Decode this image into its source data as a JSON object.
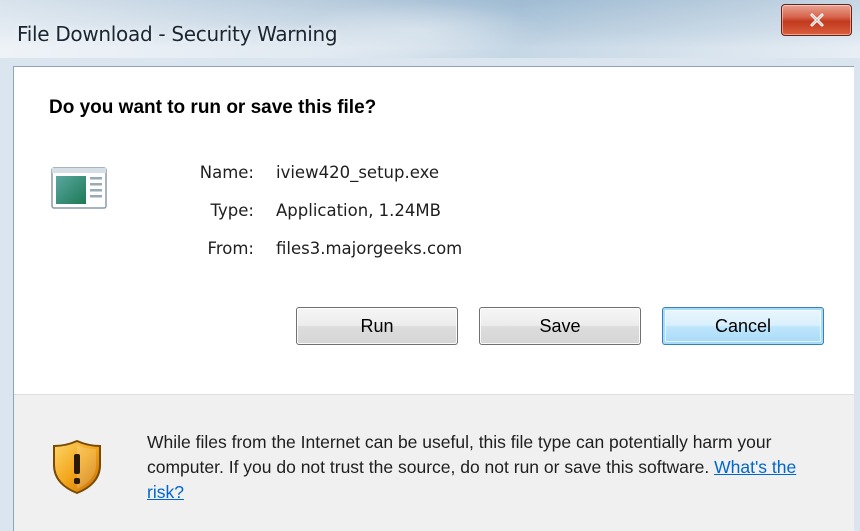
{
  "window": {
    "title": "File Download - Security Warning",
    "close_label": "Close"
  },
  "dialog": {
    "question": "Do you want to run or save this file?",
    "file": {
      "name_label": "Name:",
      "name_value": "iview420_setup.exe",
      "type_label": "Type:",
      "type_value": "Application, 1.24MB",
      "from_label": "From:",
      "from_value": "files3.majorgeeks.com"
    },
    "buttons": {
      "run": "Run",
      "save": "Save",
      "cancel": "Cancel"
    },
    "warning": {
      "text": "While files from the Internet can be useful, this file type can potentially harm your computer. If you do not trust the source, do not run or save this software. ",
      "link": "What's the risk?"
    }
  },
  "colors": {
    "link": "#0066cc",
    "close_button": "#c2391d",
    "default_button_border": "#3c7fb1"
  },
  "icons": {
    "file": "application-file-icon",
    "warning": "security-shield-icon",
    "close": "close-x-icon"
  }
}
